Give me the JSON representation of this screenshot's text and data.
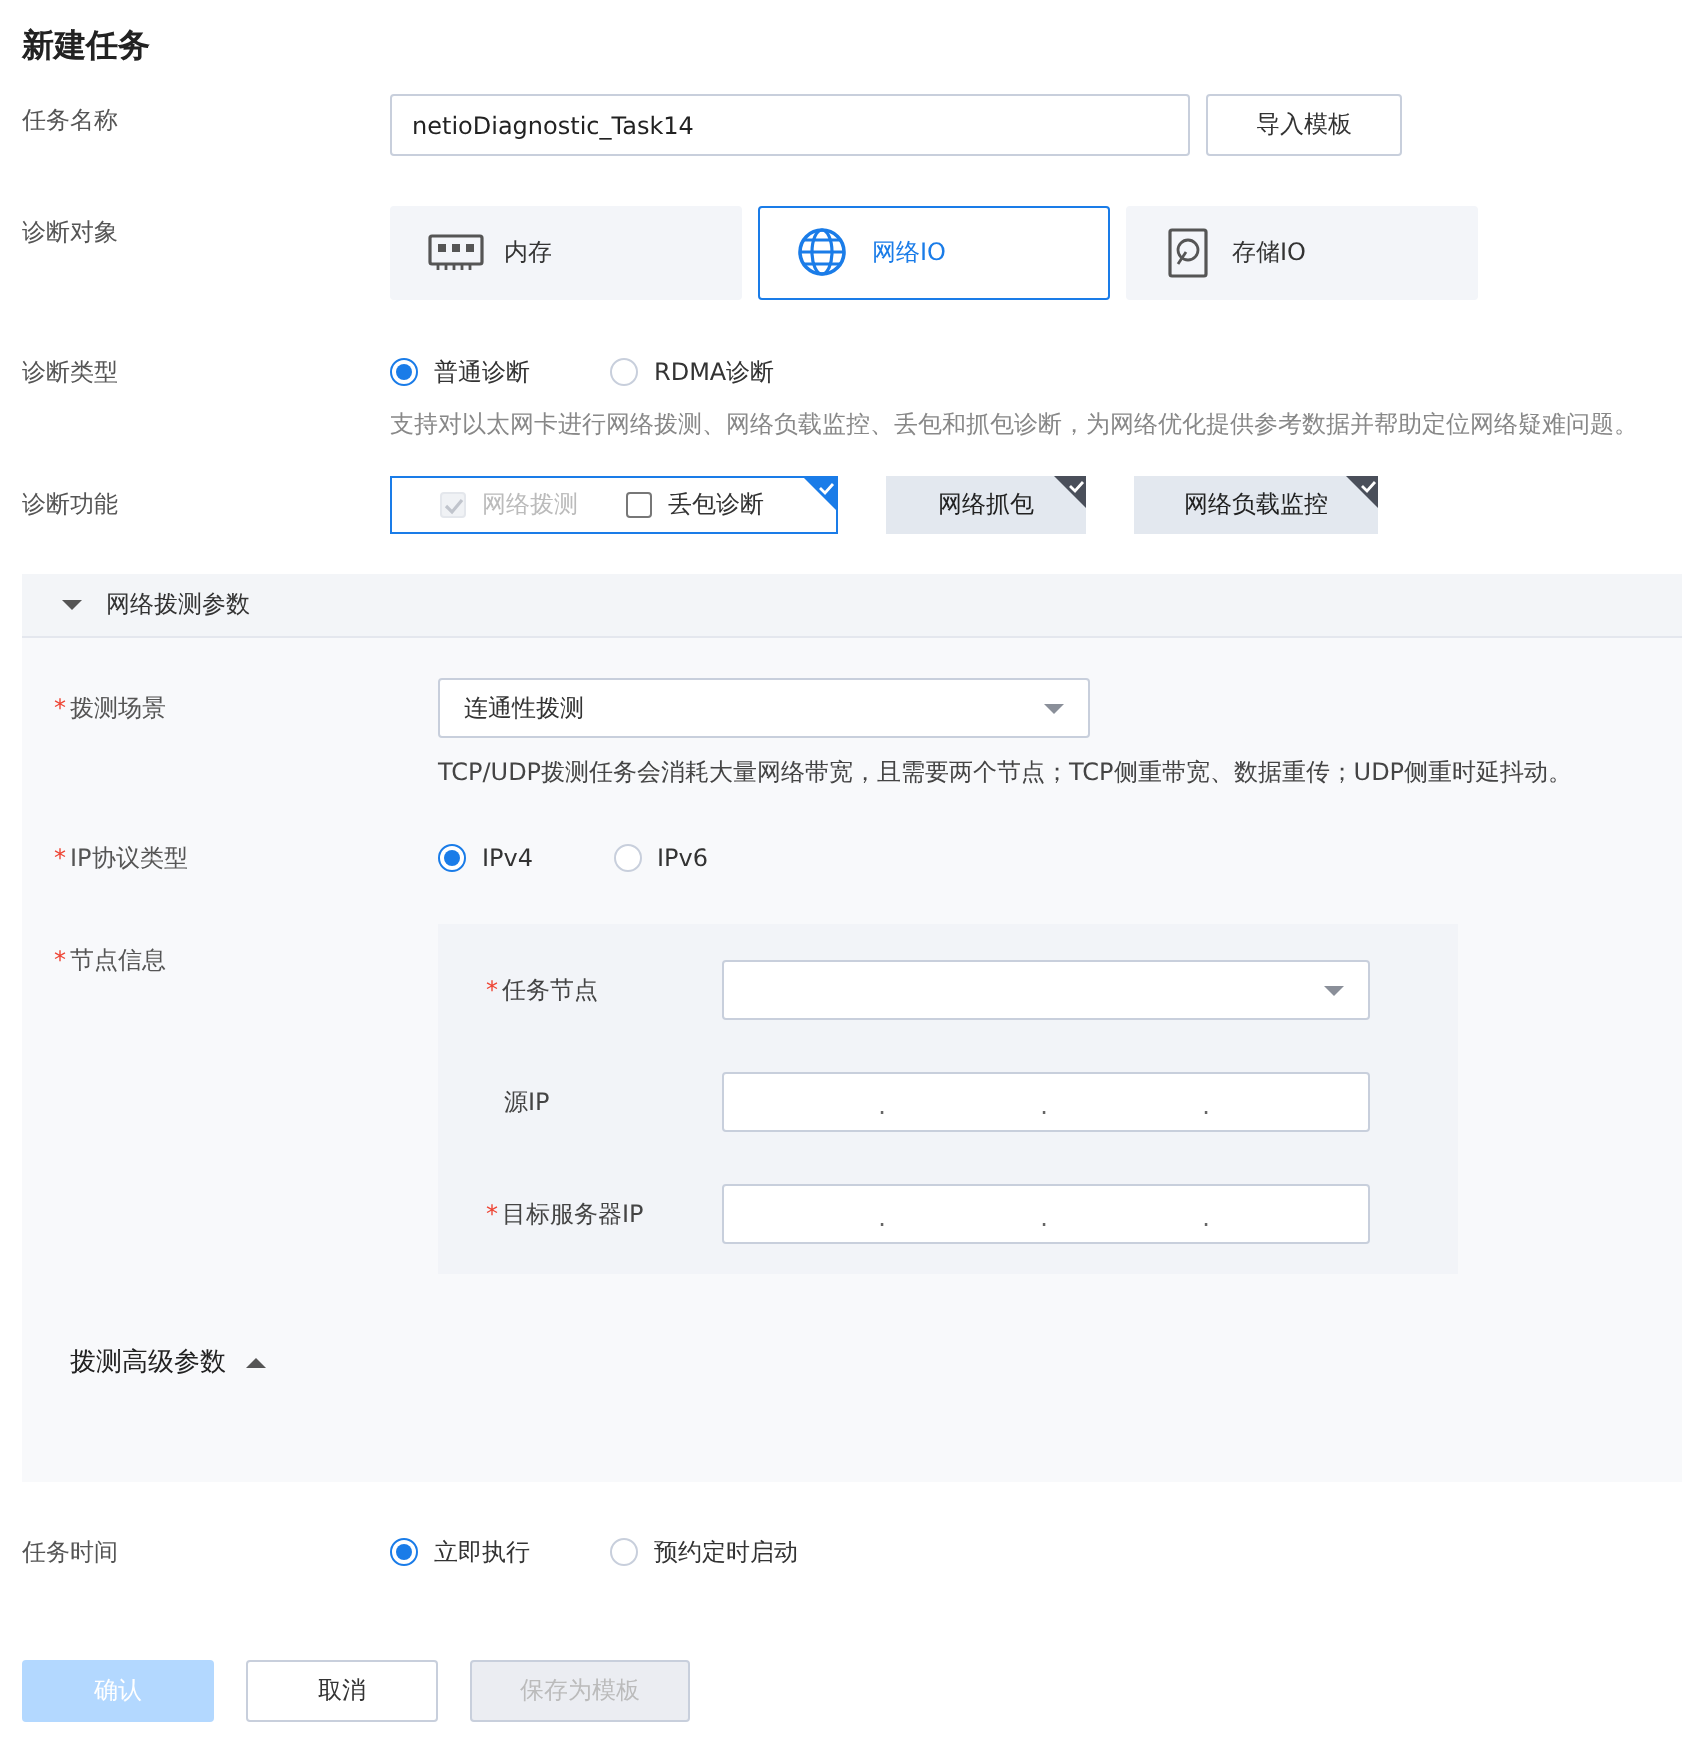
{
  "title": "新建任务",
  "task_name": {
    "label": "任务名称",
    "value": "netioDiagnostic_Task14",
    "import_button": "导入模板"
  },
  "diagnosis_target": {
    "label": "诊断对象",
    "options": [
      {
        "label": "内存",
        "kind": "memory",
        "selected": false
      },
      {
        "label": "网络IO",
        "kind": "network",
        "selected": true
      },
      {
        "label": "存储IO",
        "kind": "storage",
        "selected": false
      }
    ]
  },
  "diagnosis_type": {
    "label": "诊断类型",
    "options": [
      {
        "label": "普通诊断",
        "selected": true
      },
      {
        "label": "RDMA诊断",
        "selected": false
      }
    ],
    "hint": "支持对以太网卡进行网络拨测、网络负载监控、丢包和抓包诊断，为网络优化提供参考数据并帮助定位网络疑难问题。"
  },
  "diagnosis_functions": {
    "label": "诊断功能",
    "items": [
      {
        "selected": true,
        "checks": [
          {
            "label": "网络拨测",
            "checked": true,
            "disabled": true
          },
          {
            "label": "丢包诊断",
            "checked": false,
            "disabled": false
          }
        ]
      },
      {
        "label": "网络抓包",
        "selected": false
      },
      {
        "label": "网络负载监控",
        "selected": false
      }
    ]
  },
  "probe_section": {
    "title": "网络拨测参数",
    "expanded": true,
    "scenario": {
      "label": "拨测场景",
      "required_mark": "*",
      "value": "连通性拨测",
      "hint": "TCP/UDP拨测任务会消耗大量网络带宽，且需要两个节点；TCP侧重带宽、数据重传；UDP侧重时延抖动。"
    },
    "ip_type": {
      "label": "IP协议类型",
      "required_mark": "*",
      "options": [
        {
          "label": "IPv4",
          "selected": true
        },
        {
          "label": "IPv6",
          "selected": false
        }
      ]
    },
    "node_info": {
      "label": "节点信息",
      "required_mark": "*",
      "fields": [
        {
          "label": "任务节点",
          "required_mark": "*",
          "kind": "select"
        },
        {
          "label": "源IP",
          "kind": "ip",
          "separators": [
            ".",
            ".",
            "."
          ]
        },
        {
          "label": "目标服务器IP",
          "required_mark": "*",
          "kind": "ip",
          "separators": [
            ".",
            ".",
            "."
          ]
        }
      ]
    },
    "advanced": {
      "label": "拨测高级参数",
      "expanded": false
    }
  },
  "task_time": {
    "label": "任务时间",
    "options": [
      {
        "label": "立即执行",
        "selected": true
      },
      {
        "label": "预约定时启动",
        "selected": false
      }
    ]
  },
  "buttons": [
    {
      "label": "确认",
      "kind": "primary",
      "disabled": true
    },
    {
      "label": "取消",
      "kind": "default",
      "disabled": false
    },
    {
      "label": "保存为模板",
      "kind": "default",
      "disabled": true
    }
  ]
}
